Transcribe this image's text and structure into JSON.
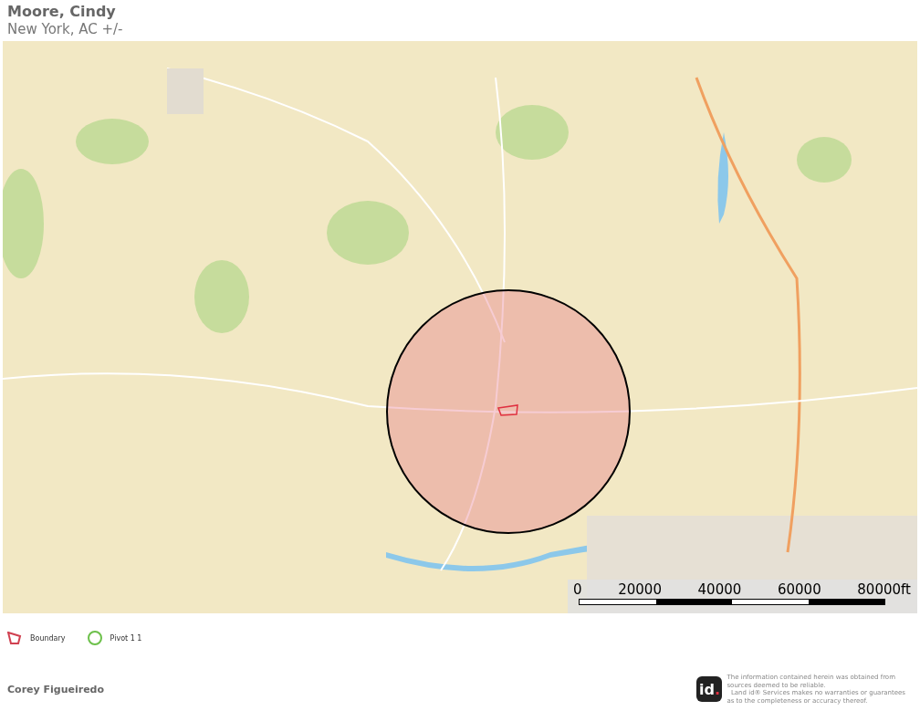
{
  "header": {
    "title": "Moore, Cindy",
    "subtitle": "New York,  AC +/-"
  },
  "map": {
    "kind": "picture",
    "scale_bar": {
      "labels": [
        "0",
        "20000",
        "40000",
        "60000",
        "80000ft"
      ]
    }
  },
  "legend": [
    {
      "kind": "boundary",
      "label": "Boundary"
    },
    {
      "kind": "pivot",
      "label": "Pivot 1 1"
    }
  ],
  "footer": {
    "author": "Corey Figueiredo",
    "logo": {
      "text": "id",
      "dot": "."
    },
    "disclaimer": "The information contained herein was obtained from\nsources deemed to be reliable.\n  Land id® Services makes no warranties or guarantees\nas to the completeness or accuracy thereof."
  }
}
